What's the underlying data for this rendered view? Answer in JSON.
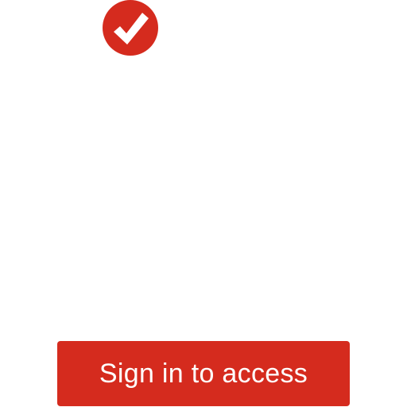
{
  "brand": {
    "logo_icon": "checkmark-icon",
    "color": "#d52b1e"
  },
  "signin": {
    "label": "Sign in to access",
    "background": "#d52b1e",
    "text_color": "#ffffff"
  }
}
